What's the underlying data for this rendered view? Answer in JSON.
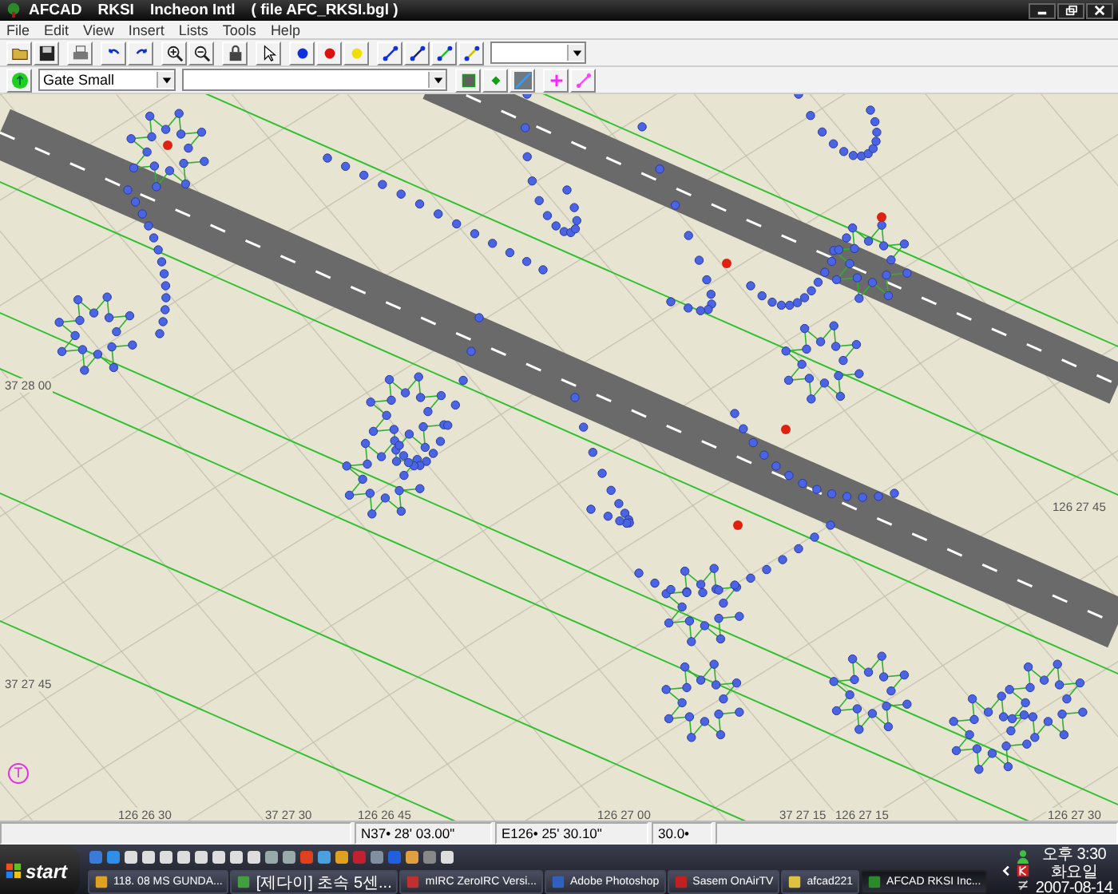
{
  "window": {
    "title_parts": [
      "AFCAD",
      "RKSI",
      "Incheon Intl",
      "( file AFC_RKSI.bgl )"
    ]
  },
  "menu": [
    "File",
    "Edit",
    "View",
    "Insert",
    "Lists",
    "Tools",
    "Help"
  ],
  "toolbar": {
    "object_combo": {
      "value": "Gate Small"
    }
  },
  "map": {
    "grid_labels": [
      "37 28 00",
      "37 27 45",
      "126 27 45",
      "126 26 30",
      "37 27 30",
      "126 26 45",
      "126 27 00",
      "37 27 15",
      "126 27 15",
      "126 27 30"
    ],
    "marker": "T"
  },
  "status_bar": {
    "latitude": "N37• 28' 03.00\"",
    "longitude": "E126• 25' 30.10\"",
    "zoom": "30.0•"
  },
  "taskbar": {
    "start": "start",
    "tasks": [
      {
        "label": "118. 08 MS GUNDA...",
        "selected": false
      },
      {
        "label": "[제다이] 초속 5센...",
        "selected": false
      },
      {
        "label": "mIRC ZeroIRC Versi...",
        "selected": false
      },
      {
        "label": "Adobe Photoshop",
        "selected": false
      },
      {
        "label": "Sasem OnAirTV",
        "selected": false
      },
      {
        "label": "afcad221",
        "selected": false
      },
      {
        "label": "AFCAD   RKSI   Inc...",
        "selected": true
      }
    ],
    "clock": {
      "time": "오후 3:30",
      "day": "화요일",
      "date": "2007-08-14"
    }
  }
}
